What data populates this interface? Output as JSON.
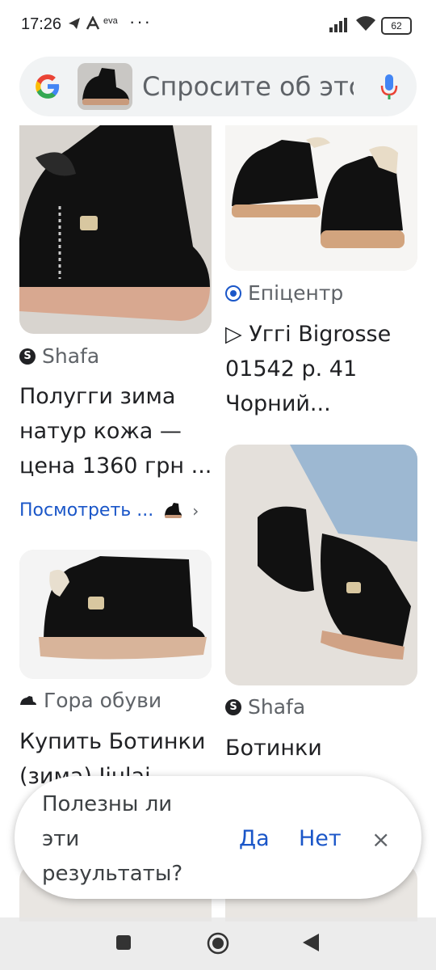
{
  "status": {
    "time": "17:26",
    "carrier": "eva",
    "dots": "···",
    "battery": "62"
  },
  "search": {
    "placeholder": "Спросите об этом"
  },
  "results": {
    "left_1": {
      "source": "Shafa",
      "title": "Полугги зима натур кожа — цена 1360 грн ...",
      "link": "Посмотреть ..."
    },
    "right_1": {
      "source": "Епіцентр",
      "title": "▷ Уггі Bigrosse 01542 р. 41 Чорний..."
    },
    "left_2": {
      "source": "Гора обуви",
      "title": "Купить Ботинки (зима) Jiulai"
    },
    "right_2": {
      "source": "Shafa",
      "title": "Ботинки"
    }
  },
  "feedback": {
    "question": "Полезны ли эти результаты?",
    "yes": "Да",
    "no": "Нет",
    "close": "×"
  },
  "colors": {
    "accent": "#1a56c8",
    "background": "#ffffff"
  }
}
